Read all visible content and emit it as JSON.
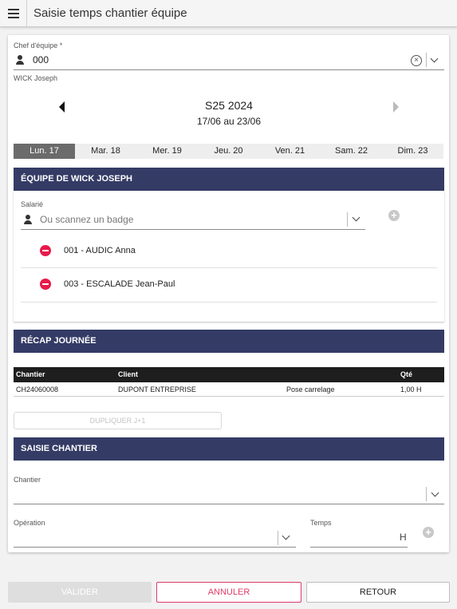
{
  "app": {
    "title": "Saisie temps chantier équipe"
  },
  "chef": {
    "label": "Chef d'équipe *",
    "value": "000",
    "name": "WICK Joseph"
  },
  "week": {
    "title": "S25 2024",
    "range": "17/06 au 23/06"
  },
  "days": [
    "Lun. 17",
    "Mar. 18",
    "Mer. 19",
    "Jeu. 20",
    "Ven. 21",
    "Sam. 22",
    "Dim. 23"
  ],
  "active_day": "Lun. 17",
  "team": {
    "header": "ÉQUIPE DE WICK JOSEPH",
    "salarie_label": "Salarié",
    "salarie_placeholder": "Ou scannez un badge",
    "members": [
      "001 - AUDIC Anna",
      "003 - ESCALADE Jean-Paul"
    ]
  },
  "recap": {
    "header": "RÉCAP JOURNÉE",
    "columns": {
      "chantier": "Chantier",
      "client": "Client",
      "operation": "",
      "qte": "Qté"
    },
    "rows": [
      {
        "chantier": "CH24060008",
        "client": "DUPONT ENTREPRISE",
        "operation": "Pose carrelage",
        "qte": "1,00 H"
      }
    ]
  },
  "duplicate_label": "DUPLIQUER J+1",
  "saisie": {
    "header": "SAISIE CHANTIER",
    "chantier_label": "Chantier",
    "operation_label": "Opération",
    "temps_label": "Temps",
    "temps_unit": "H"
  },
  "footer": {
    "valider": "VALIDER",
    "annuler": "ANNULER",
    "retour": "RETOUR"
  },
  "colors": {
    "header_bg": "#343b65",
    "remove": "#e8194a",
    "annuler": "#e03a6a",
    "active_day": "#6b6b6b"
  }
}
